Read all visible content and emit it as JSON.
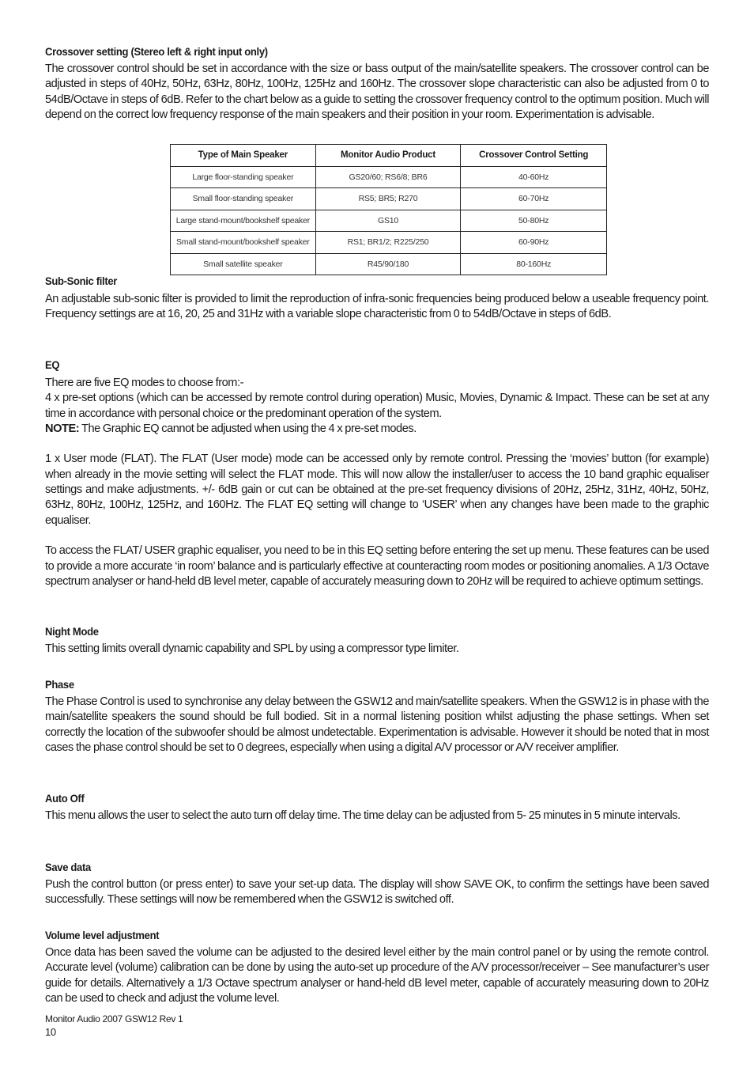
{
  "sections": {
    "crossover": {
      "heading": "Crossover setting (Stereo left & right input only)",
      "body": "The crossover control should be set in accordance with the size or bass output of the main/satellite speakers. The crossover control can be adjusted in steps of 40Hz, 50Hz, 63Hz, 80Hz, 100Hz, 125Hz and 160Hz. The crossover slope characteristic can also be adjusted from 0 to 54dB/Octave in steps of 6dB. Refer to the chart below as a guide to setting the crossover frequency control to the optimum position. Much will depend on the correct low frequency response of the main speakers and their position in your room. Experimentation is advisable."
    },
    "crossover_table": {
      "headers": [
        "Type of Main Speaker",
        "Monitor Audio Product",
        "Crossover Control Setting"
      ],
      "rows": [
        [
          "Large floor-standing speaker",
          "GS20/60; RS6/8; BR6",
          "40-60Hz"
        ],
        [
          "Small floor-standing speaker",
          "RS5; BR5; R270",
          "60-70Hz"
        ],
        [
          "Large stand-mount/bookshelf speaker",
          "GS10",
          "50-80Hz"
        ],
        [
          "Small stand-mount/bookshelf speaker",
          "RS1; BR1/2; R225/250",
          "60-90Hz"
        ],
        [
          "Small satellite speaker",
          "R45/90/180",
          "80-160Hz"
        ]
      ]
    },
    "subsonic": {
      "heading": "Sub-Sonic filter",
      "body": "An adjustable sub-sonic filter is provided to limit the reproduction of infra-sonic frequencies being produced below a useable frequency point. Frequency settings are at 16, 20, 25 and 31Hz with a variable slope characteristic from 0 to 54dB/Octave in steps of 6dB."
    },
    "eq": {
      "heading": "EQ",
      "intro": "There are five EQ modes to choose from:-",
      "presets": "4 x pre-set options (which can be accessed by remote control during operation) Music, Movies, Dynamic & Impact. These can be set at any time in accordance with personal choice or the predominant operation of the system.",
      "note_label": "NOTE:",
      "note_text": " The Graphic EQ cannot be adjusted when using the 4 x pre-set modes.",
      "user_mode": "1 x User mode (FLAT). The FLAT (User mode) mode can be accessed only by remote control. Pressing the ‘movies’ button (for example) when already in the movie setting will select the FLAT mode. This will now allow the installer/user to access the 10 band graphic equaliser settings and make adjustments. +/- 6dB gain or cut can be obtained at the pre-set frequency divisions of 20Hz, 25Hz, 31Hz, 40Hz, 50Hz, 63Hz, 80Hz, 100Hz, 125Hz, and 160Hz. The FLAT EQ setting will change to ‘USER’ when any changes have been made to the graphic equaliser.",
      "access": "To access the FLAT/ USER graphic equaliser, you need to be in this EQ setting before entering the set up menu. These features can be used to provide a more accurate ‘in room’ balance and is particularly effective at counteracting room modes or positioning anomalies. A 1/3 Octave spectrum analyser or hand-held dB level meter, capable of accurately measuring down to 20Hz will be required to achieve optimum settings."
    },
    "night_mode": {
      "heading": "Night Mode",
      "body": "This setting limits overall dynamic capability and SPL by using a compressor type limiter."
    },
    "phase": {
      "heading": "Phase",
      "body": "The Phase Control is used to synchronise any delay between the GSW12 and main/satellite speakers. When the GSW12 is in phase with the main/satellite speakers the sound should be full bodied. Sit in a normal listening position whilst adjusting the phase settings. When set correctly the location of the subwoofer should be almost undetectable. Experimentation is advisable. However it should be noted that in most cases the phase control should be set to 0 degrees, especially when using a digital A/V processor or A/V receiver amplifier."
    },
    "auto_off": {
      "heading": "Auto Off",
      "body": "This menu allows the user to select the auto turn off delay time. The time delay can be adjusted from 5- 25 minutes in 5 minute intervals."
    },
    "save_data": {
      "heading": "Save data",
      "body": "Push the control button (or press enter) to save your set-up data. The display will show SAVE OK, to confirm the settings have been saved successfully. These settings will now be remembered when the GSW12 is switched off."
    },
    "volume": {
      "heading": "Volume level adjustment",
      "body": "Once data has been saved the volume can be adjusted to the desired level either by the main control panel or by using the remote control. Accurate level (volume) calibration can be done by using the auto-set up procedure of the A/V processor/receiver – See manufacturer’s user guide for details. Alternatively a 1/3 Octave spectrum analyser or hand-held dB level meter, capable of accurately measuring down to 20Hz can be used to check and adjust the volume level."
    }
  },
  "footer": {
    "doc_info": "Monitor Audio 2007 GSW12 Rev 1",
    "page_number": "10"
  }
}
